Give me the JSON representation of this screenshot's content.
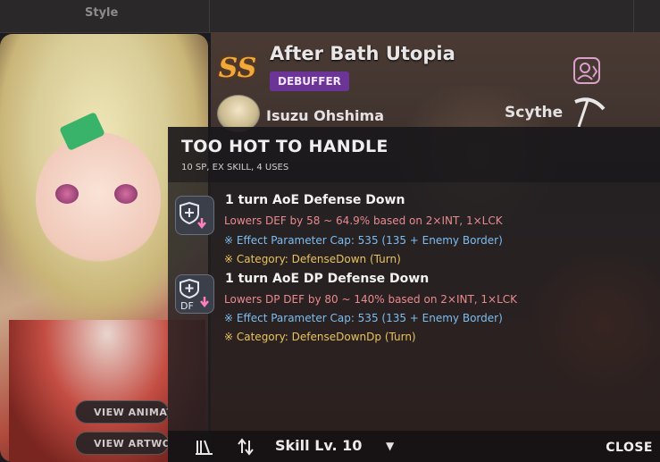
{
  "top_bar": {
    "style_label": "Style"
  },
  "portrait": {
    "view_animation_label": "VIEW ANIMATI",
    "view_artwork_label": "VIEW ARTWO"
  },
  "skill_card": {
    "rank_badge": "SS",
    "style_name": "After Bath Utopia",
    "role": "DEBUFFER",
    "character_name": "Isuzu Ohshima",
    "weapon": "Scythe",
    "colors": {
      "rank": "#f2a93b",
      "role_badge": "#6d3497"
    }
  },
  "skill_tooltip": {
    "title": "TOO HOT TO HANDLE",
    "subtitle": "10 SP, EX SKILL, 4 USES",
    "effects": [
      {
        "icon": "shield-down-icon",
        "icon_text": "",
        "title": "1 turn AoE Defense Down",
        "description": "Lowers DEF by 58 ~ 64.9% based on 2×INT, 1×LCK",
        "cap": "※ Effect Parameter Cap: 535 (135 + Enemy Border)",
        "category": "※ Category: DefenseDown (Turn)"
      },
      {
        "icon": "shield-df-down-icon",
        "icon_text": "DF",
        "title": "1 turn AoE DP Defense Down",
        "description": "Lowers DP DEF by 80 ~ 140% based on 2×INT, 1×LCK",
        "cap": "※ Effect Parameter Cap: 535 (135 + Enemy Border)",
        "category": "※ Category: DefenseDownDp (Turn)"
      }
    ],
    "colors": {
      "description": "#e98a8f",
      "cap": "#7dbdf0",
      "category": "#e9c35f"
    }
  },
  "bottom_bar": {
    "skill_level_label": "Skill Lv. 10",
    "close_label": "CLOSE"
  }
}
